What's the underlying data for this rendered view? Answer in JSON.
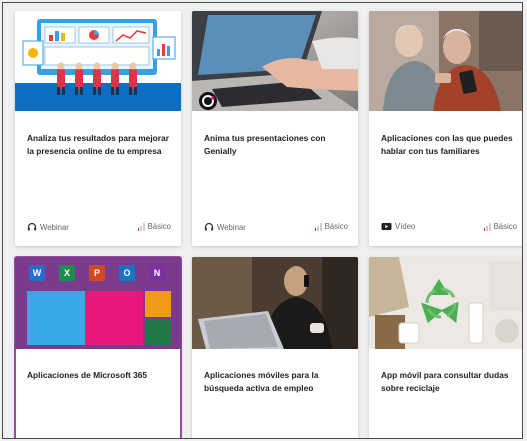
{
  "cards": [
    {
      "title": "Analiza tus resultados para mejorar la presencia online de tu empresa",
      "type": "Webinar",
      "type_icon": "headset-icon",
      "level": "Básico",
      "level_bars_filled": 1,
      "image": "analytics-illustration"
    },
    {
      "title": "Anima tus presentaciones con Genially",
      "type": "Webinar",
      "type_icon": "headset-icon",
      "level": "Básico",
      "level_bars_filled": 1,
      "image": "laptop-typing-photo"
    },
    {
      "title": "Aplicaciones con las que puedes hablar con tus familiares",
      "type": "Vídeo",
      "type_icon": "video-icon",
      "level": "Básico",
      "level_bars_filled": 1,
      "image": "elderly-couple-photo"
    },
    {
      "title": "Aplicaciones de Microsoft 365",
      "image": "microsoft-365-apps",
      "ms_apps": [
        "W",
        "X",
        "P",
        "O",
        "N"
      ]
    },
    {
      "title": "Aplicaciones móviles para la búsqueda activa de empleo",
      "image": "man-phone-laptop-photo"
    },
    {
      "title": "App móvil para consultar dudas sobre reciclaje",
      "image": "recycling-photo"
    }
  ],
  "colors": {
    "level_bar": "#e2272b",
    "selected_border": "#9b4aa4",
    "ms_purple": "#7a3b8c"
  }
}
